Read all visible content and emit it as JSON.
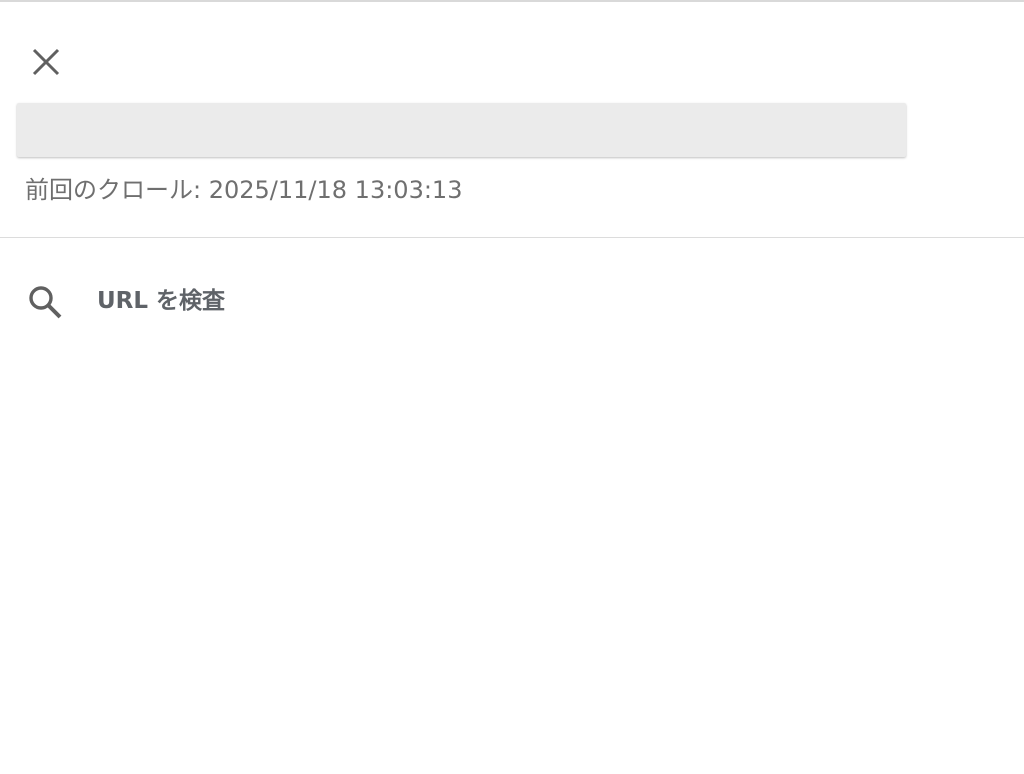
{
  "header": {
    "close_icon": "close-icon"
  },
  "url_field": {
    "value": "",
    "placeholder": ""
  },
  "status": {
    "last_crawl": "前回のクロール: 2025/11/18 13:03:13"
  },
  "menu": {
    "items": [
      {
        "label": "URL を検査",
        "icon": "search-icon"
      }
    ]
  },
  "colors": {
    "icon": "#606060",
    "field_background": "#ebebeb",
    "secondary_text": "#6f6f6f",
    "menu_text": "#5f6368",
    "divider": "#dcdcdc"
  }
}
